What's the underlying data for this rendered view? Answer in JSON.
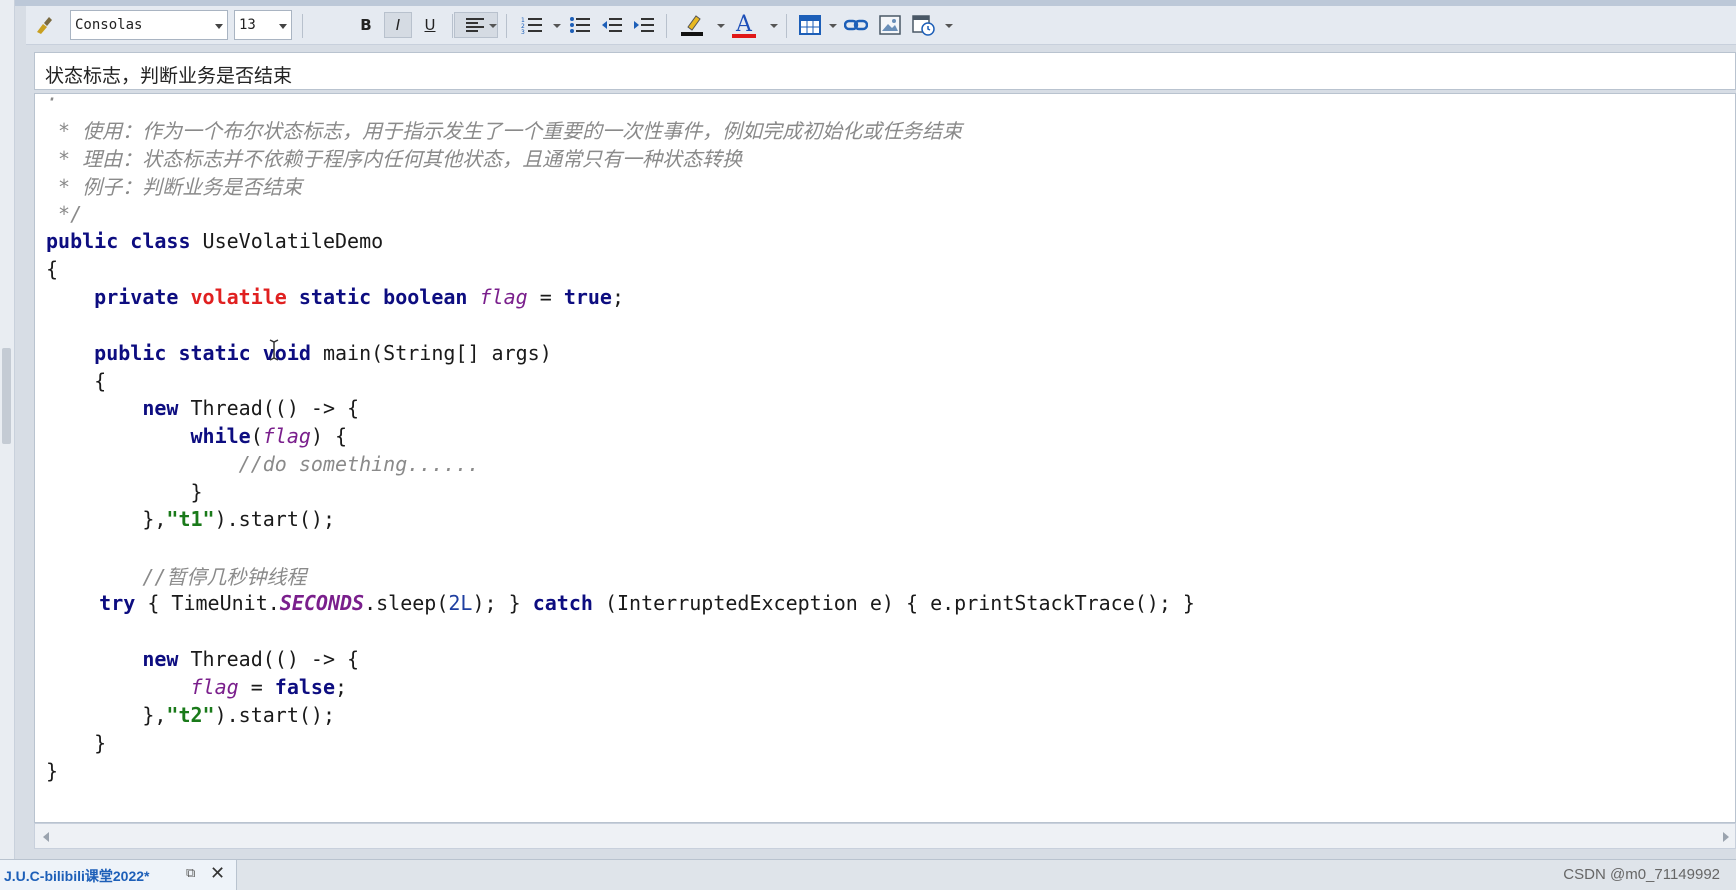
{
  "toolbar": {
    "font_family": "Consolas",
    "font_size": "13",
    "bold_label": "B",
    "italic_label": "I",
    "underline_label": "U",
    "font_color_label": "A"
  },
  "note_title": "状态标志，判断业务是否结束",
  "code_lines": {
    "l0": "·",
    "l1": " * 使用：作为一个布尔状态标志，用于指示发生了一个重要的一次性事件，例如完成初始化或任务结束",
    "l2": " * 理由：状态标志并不依赖于程序内任何其他状态，且通常只有一种状态转换",
    "l3": " * 例子：判断业务是否结束",
    "l4": " */",
    "l5_kw": "public class",
    "l5_name": " UseVolatileDemo",
    "l6": "{",
    "l7_indent": "    ",
    "l7_private": "private",
    "l7_volatile": "volatile",
    "l7_static_boolean": "static boolean",
    "l7_flag": "flag",
    "l7_eq": " = ",
    "l7_true": "true",
    "l7_semi": ";",
    "l9_indent": "    ",
    "l9_kw": "public static void",
    "l9_rest": " main(String[] args)",
    "l10": "    {",
    "l11_indent": "        ",
    "l11_new": "new",
    "l11_rest": " Thread(() -> {",
    "l12_indent": "            ",
    "l12_while": "while",
    "l12_open": "(",
    "l12_flag": "flag",
    "l12_close": ") {",
    "l13": "                //do something......",
    "l14": "            }",
    "l15_open": "        },",
    "l15_str": "\"t1\"",
    "l15_rest": ").start();",
    "l17": "        //暂停几秒钟线程",
    "l18_indent": "    ",
    "l18_try": "try",
    "l18_a": " { TimeUnit.",
    "l18_seconds": "SECONDS",
    "l18_b": ".sleep(",
    "l18_num": "2L",
    "l18_c": "); } ",
    "l18_catch": "catch",
    "l18_d": " (InterruptedException e) { e.printStackTrace(); }",
    "l20_indent": "        ",
    "l20_new": "new",
    "l20_rest": " Thread(() -> {",
    "l21_indent": "            ",
    "l21_flag": "flag",
    "l21_eq": " = ",
    "l21_false": "false",
    "l21_semi": ";",
    "l22_open": "        },",
    "l22_str": "\"t2\"",
    "l22_rest": ").start();",
    "l23": "    }",
    "l24": "}"
  },
  "status": {
    "tab_label": "J.U.C-bilibili课堂2022*",
    "watermark": "CSDN @m0_71149992"
  },
  "colors": {
    "keyword": "#0d0d80",
    "volatile": "#e02020",
    "field": "#7a1f8c",
    "comment": "#8a8a8a",
    "string": "#1a7a1a"
  }
}
